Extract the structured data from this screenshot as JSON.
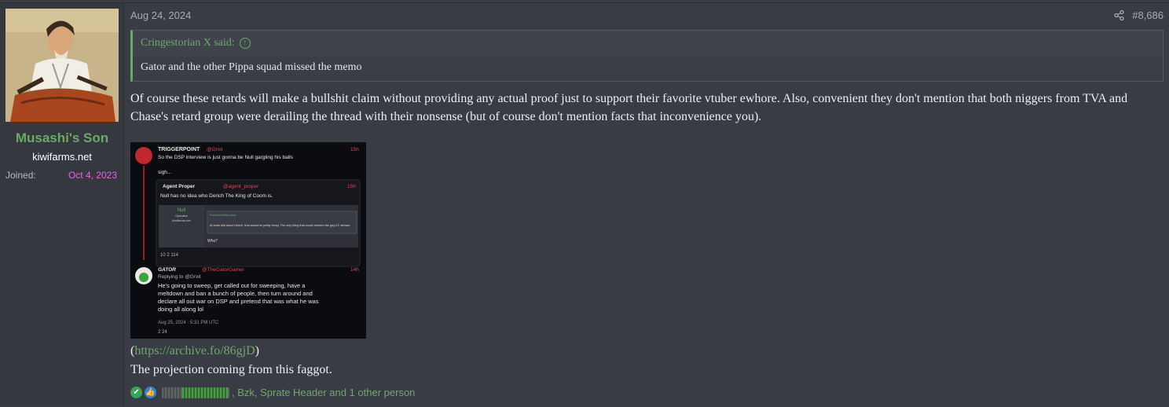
{
  "user": {
    "name": "Musashi's Son",
    "title": "kiwifarms.net",
    "joined_label": "Joined:",
    "joined_value": "Oct 4, 2023"
  },
  "post": {
    "date": "Aug 24, 2024",
    "number": "#8,686",
    "quote_author": "Cringestorian X said:",
    "quote_text": "Gator and the other Pippa squad missed the memo",
    "body": "Of course these retards will make a bullshit claim without providing any actual proof just to support their favorite vtuber ewhore. Also, convenient they don't mention that both niggers from TVA and Chase's retard group were derailing the thread with their nonsense (but of course don't mention facts that inconvenience you).",
    "link_open": "(",
    "link_text": "https://archive.fo/86gjD",
    "link_close": ")",
    "final_line": "The projection coming from this faggot.",
    "reactions_text": ", Bzk, Sprate Header and 1 other person"
  },
  "embed": {
    "tweet1_name": "TRIGGERPOINT",
    "tweet1_handle": "@Grxit",
    "tweet1_time": "15h",
    "tweet1_text": "So the DSP interview is just gonna be Null gargling his balls",
    "tweet1_sub": "sigh...",
    "tweet2_name": "Agent Proper",
    "tweet2_handle": "@agent_proper",
    "tweet2_time": "15h",
    "tweet2_text": "Null has no idea who Derich The King of Coom is.",
    "inner_user": "Null",
    "inner_role": "Operator",
    "inner_site": "kiwifarms.net",
    "inner_said": "FatHomeWife said:",
    "inner_text": "At least talk about Derich, that would be pretty funny. The only thing that would redeem the gay KC stream.",
    "inner_reply": "Who?",
    "tweet2_stats": "10   2   114",
    "tweet3_name": "GATOR",
    "tweet3_handle": "@TheGatorGamer",
    "tweet3_time": "14h",
    "tweet3_reply_to": "Replying to @Grxit",
    "tweet3_text_1": "He's going to sweep, get called out for sweeping, have a",
    "tweet3_text_2": "meltdown and ban a bunch of people, then turn around and",
    "tweet3_text_3": "declare all out war on DSP and pretend that was what he was",
    "tweet3_text_4": "doing all along lol",
    "tweet3_date": "Aug 25, 2024 · 5:31 PM UTC",
    "tweet3_stats": "2      24"
  },
  "colors": {
    "accent": "#6da86b",
    "joined": "#e862e8",
    "background": "#3a3c45"
  }
}
